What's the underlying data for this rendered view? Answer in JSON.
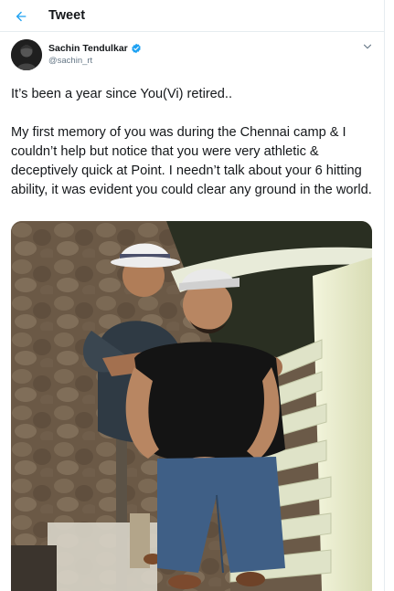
{
  "header": {
    "title": "Tweet",
    "back_icon": "arrow-left-icon",
    "accent_color": "#1da1f2"
  },
  "author": {
    "name": "Sachin Tendulkar",
    "handle": "@sachin_rt",
    "verified_icon": "verified-badge-icon",
    "more_icon": "chevron-down-icon"
  },
  "tweet": {
    "paragraphs": [
      "It’s been a year since You(Vi) retired..",
      "My first memory of you was during the Chennai camp & I couldn’t help but notice that you were very athletic & deceptively quick at Point. I needn’t talk about your 6 hitting ability, it was evident you could clear any ground in the world."
    ]
  },
  "media": {
    "type": "photo"
  }
}
